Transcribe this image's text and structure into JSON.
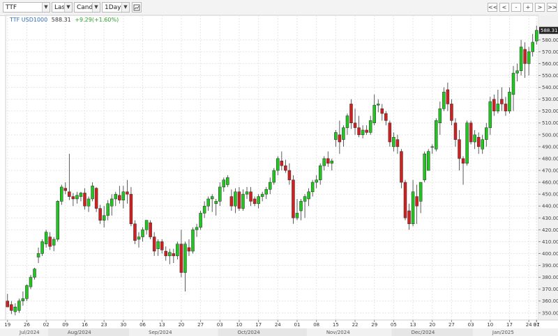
{
  "toolbar": {
    "symbol": "TTF USD/1000",
    "price_field": "Last",
    "chart_type": "Candle",
    "interval": "1Day",
    "nav": [
      "<<",
      "<",
      "-",
      "+",
      ">",
      ">>"
    ]
  },
  "header": {
    "symbol": "TTF USD1000",
    "last": "588.31",
    "change": "+9.29(+1.60%)"
  },
  "colors": {
    "up": "#1fc71f",
    "down": "#d21f1f",
    "grid": "#e6e6e6",
    "axis_bg": "#f0f0f0",
    "last_tag": "#222222"
  },
  "chart_data": {
    "type": "candlestick",
    "title": "",
    "y_axis": {
      "min": 344,
      "max": 596,
      "ticks": [
        350,
        360,
        370,
        380,
        390,
        400,
        410,
        420,
        430,
        440,
        450,
        460,
        470,
        480,
        490,
        500,
        510,
        520,
        530,
        540,
        550,
        560,
        570,
        580
      ],
      "position": "right"
    },
    "last_label": "588.31",
    "x_ticks": [
      "19",
      "26",
      "02",
      "09",
      "16",
      "23",
      "30",
      "06",
      "13",
      "20",
      "27",
      "03",
      "10",
      "17",
      "24",
      "01",
      "08",
      "15",
      "22",
      "29",
      "05",
      "13",
      "20",
      "27",
      "03",
      "10",
      "17",
      "24",
      "31",
      "07"
    ],
    "month_labels": [
      "Jul/2024",
      "Aug/2024",
      "Sep/2024",
      "Oct/2024",
      "Nov/2024",
      "Dec/2024",
      "Jan/2025"
    ],
    "candles": [
      {
        "o": 360,
        "h": 366,
        "l": 356,
        "c": 355
      },
      {
        "o": 357,
        "h": 360,
        "l": 349,
        "c": 352
      },
      {
        "o": 351,
        "h": 358,
        "l": 348,
        "c": 355
      },
      {
        "o": 352,
        "h": 362,
        "l": 350,
        "c": 360
      },
      {
        "o": 360,
        "h": 368,
        "l": 356,
        "c": 362
      },
      {
        "o": 362,
        "h": 374,
        "l": 360,
        "c": 373
      },
      {
        "o": 372,
        "h": 382,
        "l": 370,
        "c": 380
      },
      {
        "o": 380,
        "h": 388,
        "l": 378,
        "c": 387
      },
      {
        "o": 397,
        "h": 405,
        "l": 392,
        "c": 400
      },
      {
        "o": 400,
        "h": 412,
        "l": 398,
        "c": 410
      },
      {
        "o": 408,
        "h": 420,
        "l": 405,
        "c": 418
      },
      {
        "o": 414,
        "h": 418,
        "l": 403,
        "c": 406
      },
      {
        "o": 407,
        "h": 414,
        "l": 402,
        "c": 412
      },
      {
        "o": 412,
        "h": 445,
        "l": 410,
        "c": 444
      },
      {
        "o": 444,
        "h": 458,
        "l": 441,
        "c": 456
      },
      {
        "o": 455,
        "h": 460,
        "l": 450,
        "c": 453
      },
      {
        "o": 452,
        "h": 484,
        "l": 445,
        "c": 448
      },
      {
        "o": 448,
        "h": 451,
        "l": 440,
        "c": 446
      },
      {
        "o": 446,
        "h": 452,
        "l": 442,
        "c": 449
      },
      {
        "o": 448,
        "h": 452,
        "l": 444,
        "c": 451
      },
      {
        "o": 451,
        "h": 455,
        "l": 437,
        "c": 440
      },
      {
        "o": 440,
        "h": 448,
        "l": 435,
        "c": 446
      },
      {
        "o": 446,
        "h": 460,
        "l": 444,
        "c": 457
      },
      {
        "o": 455,
        "h": 456,
        "l": 435,
        "c": 438
      },
      {
        "o": 438,
        "h": 441,
        "l": 425,
        "c": 428
      },
      {
        "o": 428,
        "h": 440,
        "l": 422,
        "c": 432
      },
      {
        "o": 432,
        "h": 445,
        "l": 428,
        "c": 442
      },
      {
        "o": 440,
        "h": 450,
        "l": 432,
        "c": 446
      },
      {
        "o": 446,
        "h": 452,
        "l": 440,
        "c": 450
      },
      {
        "o": 449,
        "h": 457,
        "l": 442,
        "c": 445
      },
      {
        "o": 445,
        "h": 457,
        "l": 438,
        "c": 452
      },
      {
        "o": 452,
        "h": 462,
        "l": 442,
        "c": 450
      },
      {
        "o": 450,
        "h": 456,
        "l": 423,
        "c": 425
      },
      {
        "o": 425,
        "h": 428,
        "l": 408,
        "c": 411
      },
      {
        "o": 412,
        "h": 418,
        "l": 405,
        "c": 414
      },
      {
        "o": 414,
        "h": 422,
        "l": 410,
        "c": 420
      },
      {
        "o": 420,
        "h": 428,
        "l": 416,
        "c": 428
      },
      {
        "o": 426,
        "h": 428,
        "l": 412,
        "c": 414
      },
      {
        "o": 414,
        "h": 418,
        "l": 398,
        "c": 402
      },
      {
        "o": 404,
        "h": 412,
        "l": 398,
        "c": 410
      },
      {
        "o": 410,
        "h": 412,
        "l": 400,
        "c": 403
      },
      {
        "o": 402,
        "h": 406,
        "l": 394,
        "c": 398
      },
      {
        "o": 398,
        "h": 404,
        "l": 391,
        "c": 401
      },
      {
        "o": 400,
        "h": 404,
        "l": 392,
        "c": 398
      },
      {
        "o": 398,
        "h": 410,
        "l": 395,
        "c": 408
      },
      {
        "o": 408,
        "h": 420,
        "l": 380,
        "c": 384
      },
      {
        "o": 384,
        "h": 410,
        "l": 368,
        "c": 408
      },
      {
        "o": 405,
        "h": 412,
        "l": 398,
        "c": 402
      },
      {
        "o": 402,
        "h": 422,
        "l": 400,
        "c": 420
      },
      {
        "o": 420,
        "h": 425,
        "l": 414,
        "c": 422
      },
      {
        "o": 422,
        "h": 436,
        "l": 420,
        "c": 434
      },
      {
        "o": 434,
        "h": 444,
        "l": 430,
        "c": 440
      },
      {
        "o": 440,
        "h": 448,
        "l": 436,
        "c": 446
      },
      {
        "o": 446,
        "h": 450,
        "l": 435,
        "c": 448
      },
      {
        "o": 442,
        "h": 446,
        "l": 432,
        "c": 444
      },
      {
        "o": 444,
        "h": 460,
        "l": 440,
        "c": 456
      },
      {
        "o": 456,
        "h": 464,
        "l": 452,
        "c": 462
      },
      {
        "o": 458,
        "h": 466,
        "l": 456,
        "c": 464
      },
      {
        "o": 448,
        "h": 454,
        "l": 436,
        "c": 440
      },
      {
        "o": 440,
        "h": 455,
        "l": 434,
        "c": 452
      },
      {
        "o": 452,
        "h": 456,
        "l": 436,
        "c": 438
      },
      {
        "o": 438,
        "h": 454,
        "l": 436,
        "c": 450
      },
      {
        "o": 450,
        "h": 456,
        "l": 446,
        "c": 452
      },
      {
        "o": 452,
        "h": 456,
        "l": 440,
        "c": 444
      },
      {
        "o": 446,
        "h": 448,
        "l": 440,
        "c": 442
      },
      {
        "o": 442,
        "h": 450,
        "l": 438,
        "c": 448
      },
      {
        "o": 448,
        "h": 452,
        "l": 444,
        "c": 450
      },
      {
        "o": 450,
        "h": 456,
        "l": 446,
        "c": 454
      },
      {
        "o": 454,
        "h": 464,
        "l": 450,
        "c": 460
      },
      {
        "o": 460,
        "h": 472,
        "l": 458,
        "c": 470
      },
      {
        "o": 470,
        "h": 482,
        "l": 466,
        "c": 480
      },
      {
        "o": 478,
        "h": 486,
        "l": 470,
        "c": 474
      },
      {
        "o": 474,
        "h": 479,
        "l": 468,
        "c": 470
      },
      {
        "o": 470,
        "h": 476,
        "l": 458,
        "c": 462
      },
      {
        "o": 462,
        "h": 466,
        "l": 425,
        "c": 430
      },
      {
        "o": 430,
        "h": 446,
        "l": 428,
        "c": 434
      },
      {
        "o": 436,
        "h": 446,
        "l": 428,
        "c": 444
      },
      {
        "o": 444,
        "h": 450,
        "l": 430,
        "c": 448
      },
      {
        "o": 446,
        "h": 455,
        "l": 440,
        "c": 452
      },
      {
        "o": 452,
        "h": 462,
        "l": 448,
        "c": 460
      },
      {
        "o": 460,
        "h": 466,
        "l": 455,
        "c": 462
      },
      {
        "o": 462,
        "h": 476,
        "l": 458,
        "c": 474
      },
      {
        "o": 474,
        "h": 482,
        "l": 470,
        "c": 480
      },
      {
        "o": 480,
        "h": 486,
        "l": 473,
        "c": 476
      },
      {
        "o": 476,
        "h": 480,
        "l": 470,
        "c": 478
      },
      {
        "o": 496,
        "h": 504,
        "l": 490,
        "c": 502
      },
      {
        "o": 500,
        "h": 512,
        "l": 484,
        "c": 494
      },
      {
        "o": 496,
        "h": 508,
        "l": 490,
        "c": 506
      },
      {
        "o": 506,
        "h": 518,
        "l": 500,
        "c": 516
      },
      {
        "o": 526,
        "h": 530,
        "l": 505,
        "c": 510
      },
      {
        "o": 510,
        "h": 522,
        "l": 500,
        "c": 506
      },
      {
        "o": 506,
        "h": 516,
        "l": 498,
        "c": 500
      },
      {
        "o": 500,
        "h": 508,
        "l": 497,
        "c": 504
      },
      {
        "o": 504,
        "h": 508,
        "l": 500,
        "c": 502
      },
      {
        "o": 502,
        "h": 516,
        "l": 500,
        "c": 512
      },
      {
        "o": 510,
        "h": 534,
        "l": 508,
        "c": 525
      },
      {
        "o": 525,
        "h": 530,
        "l": 519,
        "c": 526
      },
      {
        "o": 522,
        "h": 526,
        "l": 512,
        "c": 518
      },
      {
        "o": 518,
        "h": 520,
        "l": 508,
        "c": 512
      },
      {
        "o": 510,
        "h": 512,
        "l": 490,
        "c": 494
      },
      {
        "o": 490,
        "h": 502,
        "l": 486,
        "c": 498
      },
      {
        "o": 496,
        "h": 500,
        "l": 484,
        "c": 490
      },
      {
        "o": 486,
        "h": 488,
        "l": 455,
        "c": 460
      },
      {
        "o": 460,
        "h": 462,
        "l": 428,
        "c": 430
      },
      {
        "o": 436,
        "h": 442,
        "l": 420,
        "c": 425
      },
      {
        "o": 425,
        "h": 462,
        "l": 423,
        "c": 452
      },
      {
        "o": 448,
        "h": 458,
        "l": 425,
        "c": 440
      },
      {
        "o": 444,
        "h": 456,
        "l": 434,
        "c": 460
      },
      {
        "o": 462,
        "h": 486,
        "l": 460,
        "c": 484
      },
      {
        "o": 470,
        "h": 488,
        "l": 470,
        "c": 486
      },
      {
        "o": 490,
        "h": 492,
        "l": 484,
        "c": 490
      },
      {
        "o": 488,
        "h": 514,
        "l": 486,
        "c": 512
      },
      {
        "o": 510,
        "h": 528,
        "l": 500,
        "c": 522
      },
      {
        "o": 522,
        "h": 540,
        "l": 520,
        "c": 536
      },
      {
        "o": 538,
        "h": 544,
        "l": 520,
        "c": 526
      },
      {
        "o": 526,
        "h": 530,
        "l": 508,
        "c": 512
      },
      {
        "o": 510,
        "h": 514,
        "l": 490,
        "c": 496
      },
      {
        "o": 496,
        "h": 504,
        "l": 470,
        "c": 480
      },
      {
        "o": 480,
        "h": 482,
        "l": 458,
        "c": 476
      },
      {
        "o": 476,
        "h": 512,
        "l": 474,
        "c": 510
      },
      {
        "o": 510,
        "h": 512,
        "l": 492,
        "c": 494
      },
      {
        "o": 494,
        "h": 504,
        "l": 488,
        "c": 500
      },
      {
        "o": 498,
        "h": 502,
        "l": 484,
        "c": 490
      },
      {
        "o": 488,
        "h": 500,
        "l": 484,
        "c": 496
      },
      {
        "o": 496,
        "h": 510,
        "l": 490,
        "c": 506
      },
      {
        "o": 506,
        "h": 532,
        "l": 500,
        "c": 528
      },
      {
        "o": 530,
        "h": 534,
        "l": 516,
        "c": 520
      },
      {
        "o": 520,
        "h": 538,
        "l": 518,
        "c": 526
      },
      {
        "o": 530,
        "h": 540,
        "l": 520,
        "c": 526
      },
      {
        "o": 526,
        "h": 532,
        "l": 516,
        "c": 520
      },
      {
        "o": 520,
        "h": 540,
        "l": 518,
        "c": 536
      },
      {
        "o": 534,
        "h": 558,
        "l": 520,
        "c": 552
      },
      {
        "o": 552,
        "h": 560,
        "l": 545,
        "c": 554
      },
      {
        "o": 554,
        "h": 580,
        "l": 550,
        "c": 574
      },
      {
        "o": 572,
        "h": 578,
        "l": 548,
        "c": 560
      },
      {
        "o": 560,
        "h": 574,
        "l": 550,
        "c": 570
      },
      {
        "o": 570,
        "h": 585,
        "l": 566,
        "c": 578
      },
      {
        "o": 579,
        "h": 592,
        "l": 576,
        "c": 588
      }
    ]
  }
}
